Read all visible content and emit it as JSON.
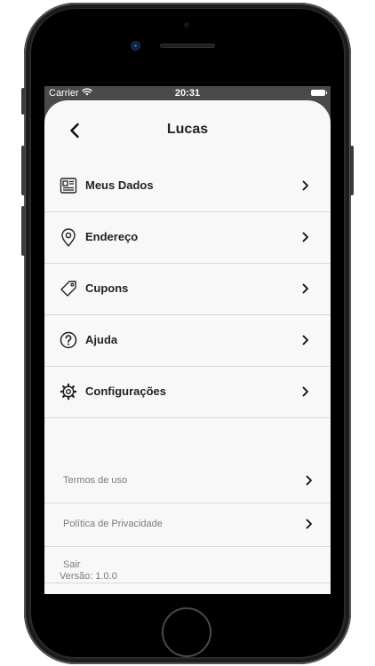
{
  "status_bar": {
    "carrier": "Carrier",
    "time": "20:31"
  },
  "nav": {
    "title": "Lucas"
  },
  "menu": [
    {
      "label": "Meus Dados",
      "icon": "id-card-icon"
    },
    {
      "label": "Endereço",
      "icon": "map-pin-icon"
    },
    {
      "label": "Cupons",
      "icon": "tag-icon"
    },
    {
      "label": "Ajuda",
      "icon": "help-circle-icon"
    },
    {
      "label": "Configurações",
      "icon": "gear-icon"
    }
  ],
  "secondary": [
    {
      "label": "Termos de uso"
    },
    {
      "label": "Política de Privacidade"
    },
    {
      "label": "Sair"
    }
  ],
  "version": "Versão: 1.0.0"
}
